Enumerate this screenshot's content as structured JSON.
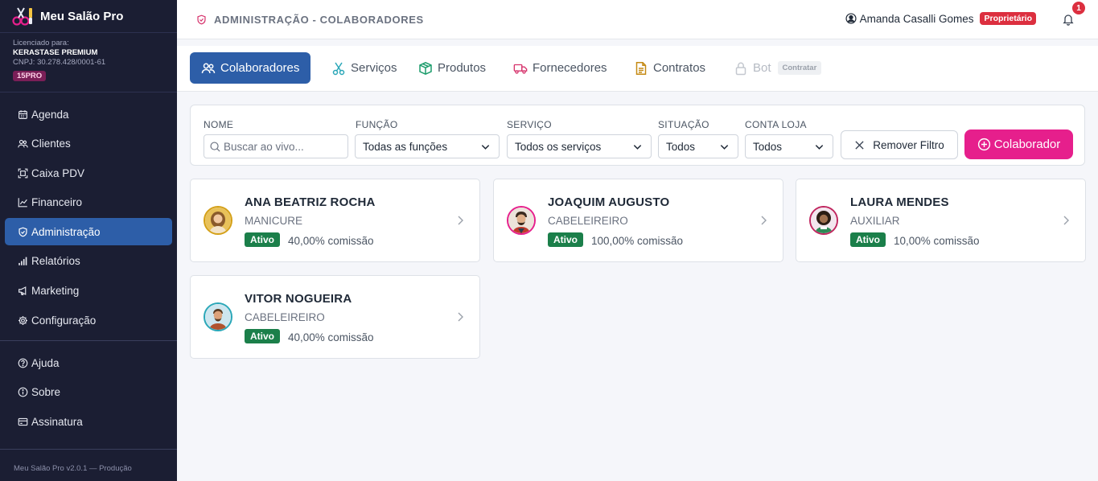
{
  "app": {
    "name": "Meu Salão Pro",
    "version": "Meu Salão Pro v2.0.1 — Produção"
  },
  "license": {
    "label": "Licenciado para:",
    "company": "KERASTASE PREMIUM",
    "cnpj": "CNPJ: 30.278.428/0001-61",
    "badge": "15PRO"
  },
  "sidebar": {
    "items": [
      {
        "label": "Agenda",
        "icon": "calendar-icon"
      },
      {
        "label": "Clientes",
        "icon": "users-icon"
      },
      {
        "label": "Caixa PDV",
        "icon": "scan-icon"
      },
      {
        "label": "Financeiro",
        "icon": "chart-line-icon"
      },
      {
        "label": "Administração",
        "icon": "shield-icon",
        "active": true
      },
      {
        "label": "Relatórios",
        "icon": "bar-chart-icon"
      },
      {
        "label": "Marketing",
        "icon": "megaphone-icon"
      },
      {
        "label": "Configuração",
        "icon": "gear-icon"
      }
    ],
    "bottom_items": [
      {
        "label": "Ajuda",
        "icon": "help-icon"
      },
      {
        "label": "Sobre",
        "icon": "info-icon"
      },
      {
        "label": "Assinatura",
        "icon": "credit-card-icon"
      }
    ]
  },
  "header": {
    "breadcrumb": "ADMINISTRAÇÃO - COLABORADORES",
    "user_name": "Amanda Casalli Gomes",
    "user_role": "Proprietário",
    "notification_count": "1"
  },
  "tabs": [
    {
      "label": "Colaboradores",
      "icon": "users-icon",
      "active": true
    },
    {
      "label": "Serviços",
      "icon": "scissors-icon"
    },
    {
      "label": "Produtos",
      "icon": "box-icon"
    },
    {
      "label": "Fornecedores",
      "icon": "truck-icon"
    },
    {
      "label": "Contratos",
      "icon": "document-icon"
    },
    {
      "label": "Bot",
      "icon": "lock-icon",
      "disabled": true,
      "badge": "Contratar"
    }
  ],
  "filters": {
    "name_label": "NOME",
    "name_placeholder": "Buscar ao vivo...",
    "function_label": "FUNÇÃO",
    "function_value": "Todas as funções",
    "service_label": "SERVIÇO",
    "service_value": "Todos os serviços",
    "status_label": "SITUAÇÃO",
    "status_value": "Todos",
    "account_label": "CONTA LOJA",
    "account_value": "Todos",
    "remove_label": "Remover Filtro",
    "add_label": "Colaborador"
  },
  "collaborators": [
    {
      "name": "ANA BEATRIZ ROCHA",
      "role": "MANICURE",
      "status": "Ativo",
      "commission": "40,00% comissão",
      "ring": "#d4a017"
    },
    {
      "name": "JOAQUIM AUGUSTO",
      "role": "CABELEIREIRO",
      "status": "Ativo",
      "commission": "100,00% comissão",
      "ring": "#e61f8c"
    },
    {
      "name": "LAURA MENDES",
      "role": "AUXILIAR",
      "status": "Ativo",
      "commission": "10,00% comissão",
      "ring": "#c0265f"
    },
    {
      "name": "VITOR NOGUEIRA",
      "role": "CABELEIREIRO",
      "status": "Ativo",
      "commission": "40,00% comissão",
      "ring": "#2aa7b8"
    }
  ],
  "colors": {
    "sidebar_bg": "#1b1e33",
    "primary": "#2d5ea8",
    "accent": "#e61f8c",
    "success": "#1b7f4a",
    "danger": "#dc2f3f"
  }
}
